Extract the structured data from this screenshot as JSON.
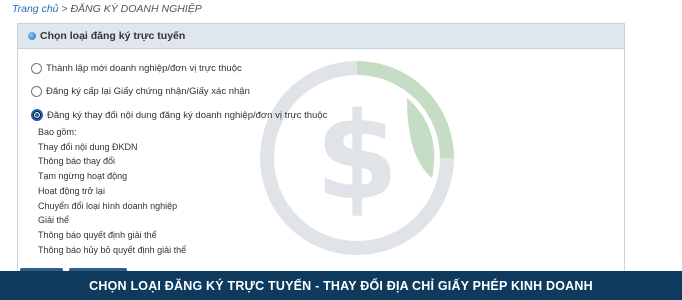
{
  "breadcrumb": {
    "home": "Trang chủ",
    "separator": " > ",
    "current": "ĐĂNG KÝ DOANH NGHIỆP"
  },
  "panel": {
    "title": "Chọn loại đăng ký trực tuyến",
    "options": [
      {
        "label": "Thành lập mới doanh nghiệp/đơn vị trực thuộc",
        "selected": false
      },
      {
        "label": "Đăng ký cấp lại Giấy chứng nhận/Giấy xác nhận",
        "selected": false
      },
      {
        "label": "Đăng ký thay đổi nội dung đăng ký doanh nghiệp/đơn vị trực thuộc",
        "selected": true
      }
    ],
    "sublist": [
      "Bao gồm:",
      "Thay đổi nội dung ĐKDN",
      "Thông báo thay đổi",
      "Tạm ngừng hoạt động",
      "Hoạt động trở lại",
      "Chuyển đổi loại hình doanh nghiệp",
      "Giải thể",
      "Thông báo quyết định giải thể",
      "Thông báo hủy bỏ quyết định giải thể"
    ]
  },
  "banner": {
    "text": "CHỌN LOẠI ĐĂNG KÝ TRỰC TUYẾN - THAY ĐỔI ĐỊA CHỈ GIẤY PHÉP KINH DOANH"
  },
  "colors": {
    "accent": "#2a6ebb",
    "banner_bg": "#0e3a5e",
    "header_bg": "#dfe6ee",
    "watermark_green": "#5aa05a",
    "watermark_grey": "#a8b4c0"
  }
}
